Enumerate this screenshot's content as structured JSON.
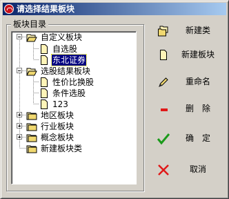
{
  "window": {
    "title": "请选择结果板块"
  },
  "group": {
    "label": "板块目录"
  },
  "tree": {
    "nodes": [
      {
        "label": "自定义板块"
      },
      {
        "label": "自选股"
      },
      {
        "label": "东北证券"
      },
      {
        "label": "选股结果板块"
      },
      {
        "label": "性价比换股"
      },
      {
        "label": "条件选股"
      },
      {
        "label": "123"
      },
      {
        "label": "地区板块"
      },
      {
        "label": "行业板块"
      },
      {
        "label": "概念板块"
      },
      {
        "label": "新建板块类"
      }
    ],
    "selected": "东北证券"
  },
  "buttons": {
    "new_category": "新建类",
    "new_block": "新建板块",
    "rename": "重命名",
    "delete": "删　除",
    "ok": "确　定",
    "cancel": "取消"
  },
  "colors": {
    "titlebar_start": "#0a246a",
    "titlebar_end": "#a6caf0",
    "ok_check": "#1a9a1a",
    "cancel_x": "#e01818",
    "delete_bar": "#e01818"
  }
}
